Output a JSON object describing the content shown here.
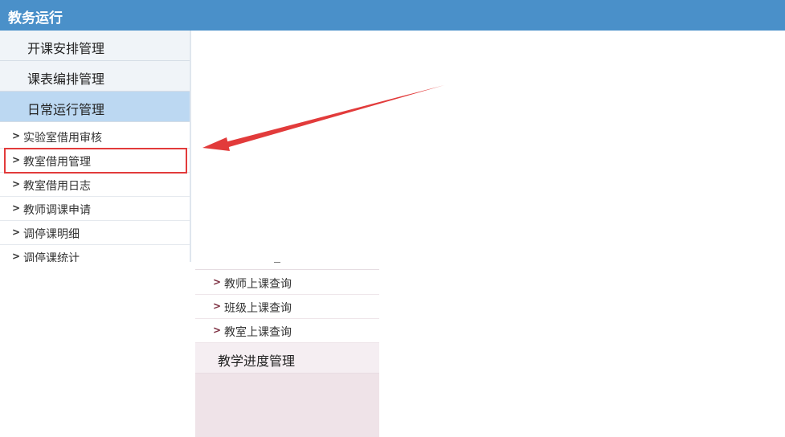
{
  "header": {
    "title": "教务运行"
  },
  "sidebar": {
    "sections": [
      {
        "label": "开课安排管理"
      },
      {
        "label": "课表编排管理"
      },
      {
        "label": "日常运行管理"
      }
    ],
    "items": [
      {
        "label": "实验室借用审核"
      },
      {
        "label": "教室借用管理"
      },
      {
        "label": "教室借用日志"
      },
      {
        "label": "教师调课申请"
      },
      {
        "label": "调停课明细"
      },
      {
        "label": "调停课统计"
      }
    ],
    "chevron": ">"
  },
  "lower_menu": {
    "items": [
      {
        "label": "教师上课查询"
      },
      {
        "label": "班级上课查询"
      },
      {
        "label": "教室上课查询"
      }
    ],
    "section": {
      "label": "教学进度管理"
    }
  },
  "colors": {
    "header_bg": "#4a90c9",
    "active_section_bg": "#bcd8f2",
    "annotation_red": "#e23b3b"
  }
}
